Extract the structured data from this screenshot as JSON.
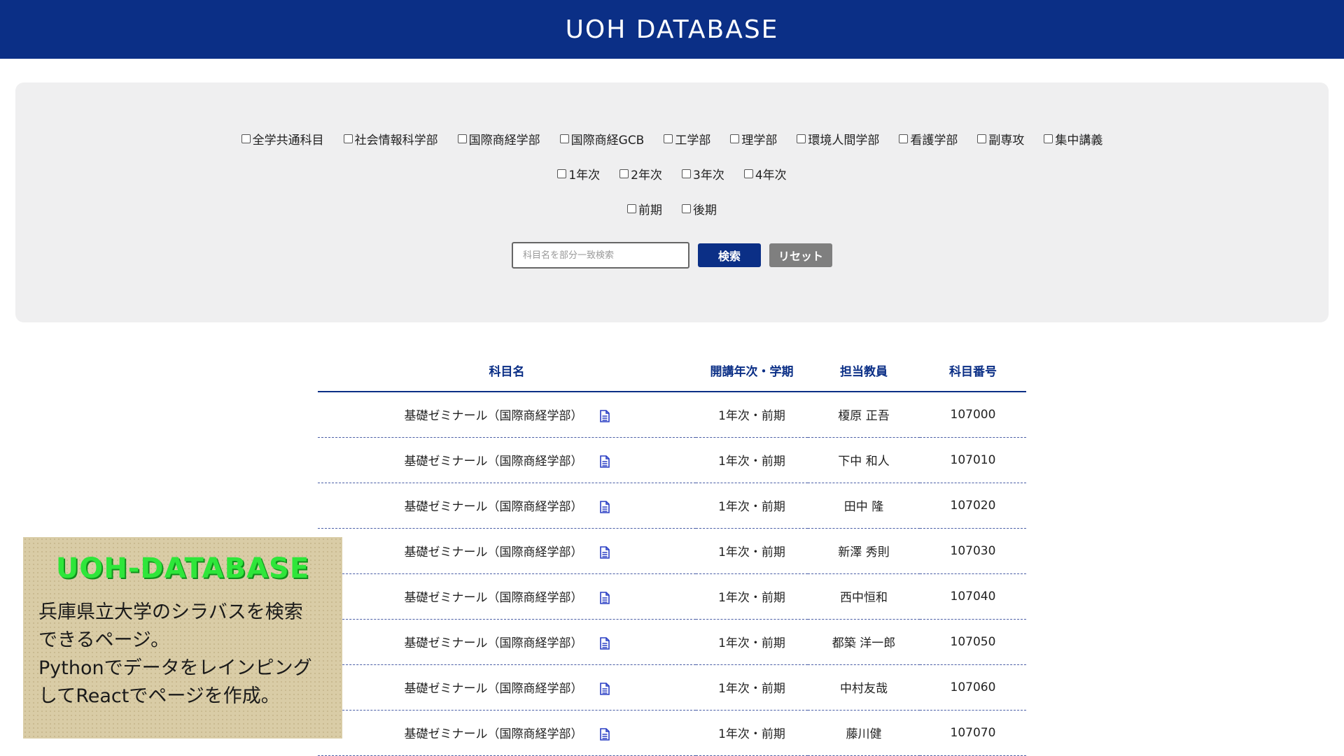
{
  "header": {
    "title": "UOH DATABASE"
  },
  "filters": {
    "faculties": [
      "全学共通科目",
      "社会情報科学部",
      "国際商経学部",
      "国際商経GCB",
      "工学部",
      "理学部",
      "環境人間学部",
      "看護学部",
      "副専攻",
      "集中講義"
    ],
    "years": [
      "1年次",
      "2年次",
      "3年次",
      "4年次"
    ],
    "terms": [
      "前期",
      "後期"
    ]
  },
  "search": {
    "placeholder": "科目名を部分一致検索",
    "search_label": "検索",
    "reset_label": "リセット"
  },
  "table": {
    "headers": [
      "科目名",
      "開講年次・学期",
      "担当教員",
      "科目番号"
    ],
    "rows": [
      [
        "基礎ゼミナール（国際商経学部）",
        "1年次・前期",
        "榎原 正吾",
        "107000"
      ],
      [
        "基礎ゼミナール（国際商経学部）",
        "1年次・前期",
        "下中 和人",
        "107010"
      ],
      [
        "基礎ゼミナール（国際商経学部）",
        "1年次・前期",
        "田中 隆",
        "107020"
      ],
      [
        "基礎ゼミナール（国際商経学部）",
        "1年次・前期",
        "新澤 秀則",
        "107030"
      ],
      [
        "基礎ゼミナール（国際商経学部）",
        "1年次・前期",
        "西中恒和",
        "107040"
      ],
      [
        "基礎ゼミナール（国際商経学部）",
        "1年次・前期",
        "都築 洋一郎",
        "107050"
      ],
      [
        "基礎ゼミナール（国際商経学部）",
        "1年次・前期",
        "中村友哉",
        "107060"
      ],
      [
        "基礎ゼミナール（国際商経学部）",
        "1年次・前期",
        "藤川健",
        "107070"
      ]
    ]
  },
  "promo": {
    "title": "UOH-DATABASE",
    "lines": [
      "兵庫県立大学のシラバスを検索",
      "できるページ。",
      "Pythonでデータをレインピング",
      "してReactでページを作成。"
    ]
  },
  "colors": {
    "brand": "#0b2f86",
    "reset": "#7f7f7f",
    "panel": "#efeff0",
    "promo_title": "#2ee63a"
  }
}
